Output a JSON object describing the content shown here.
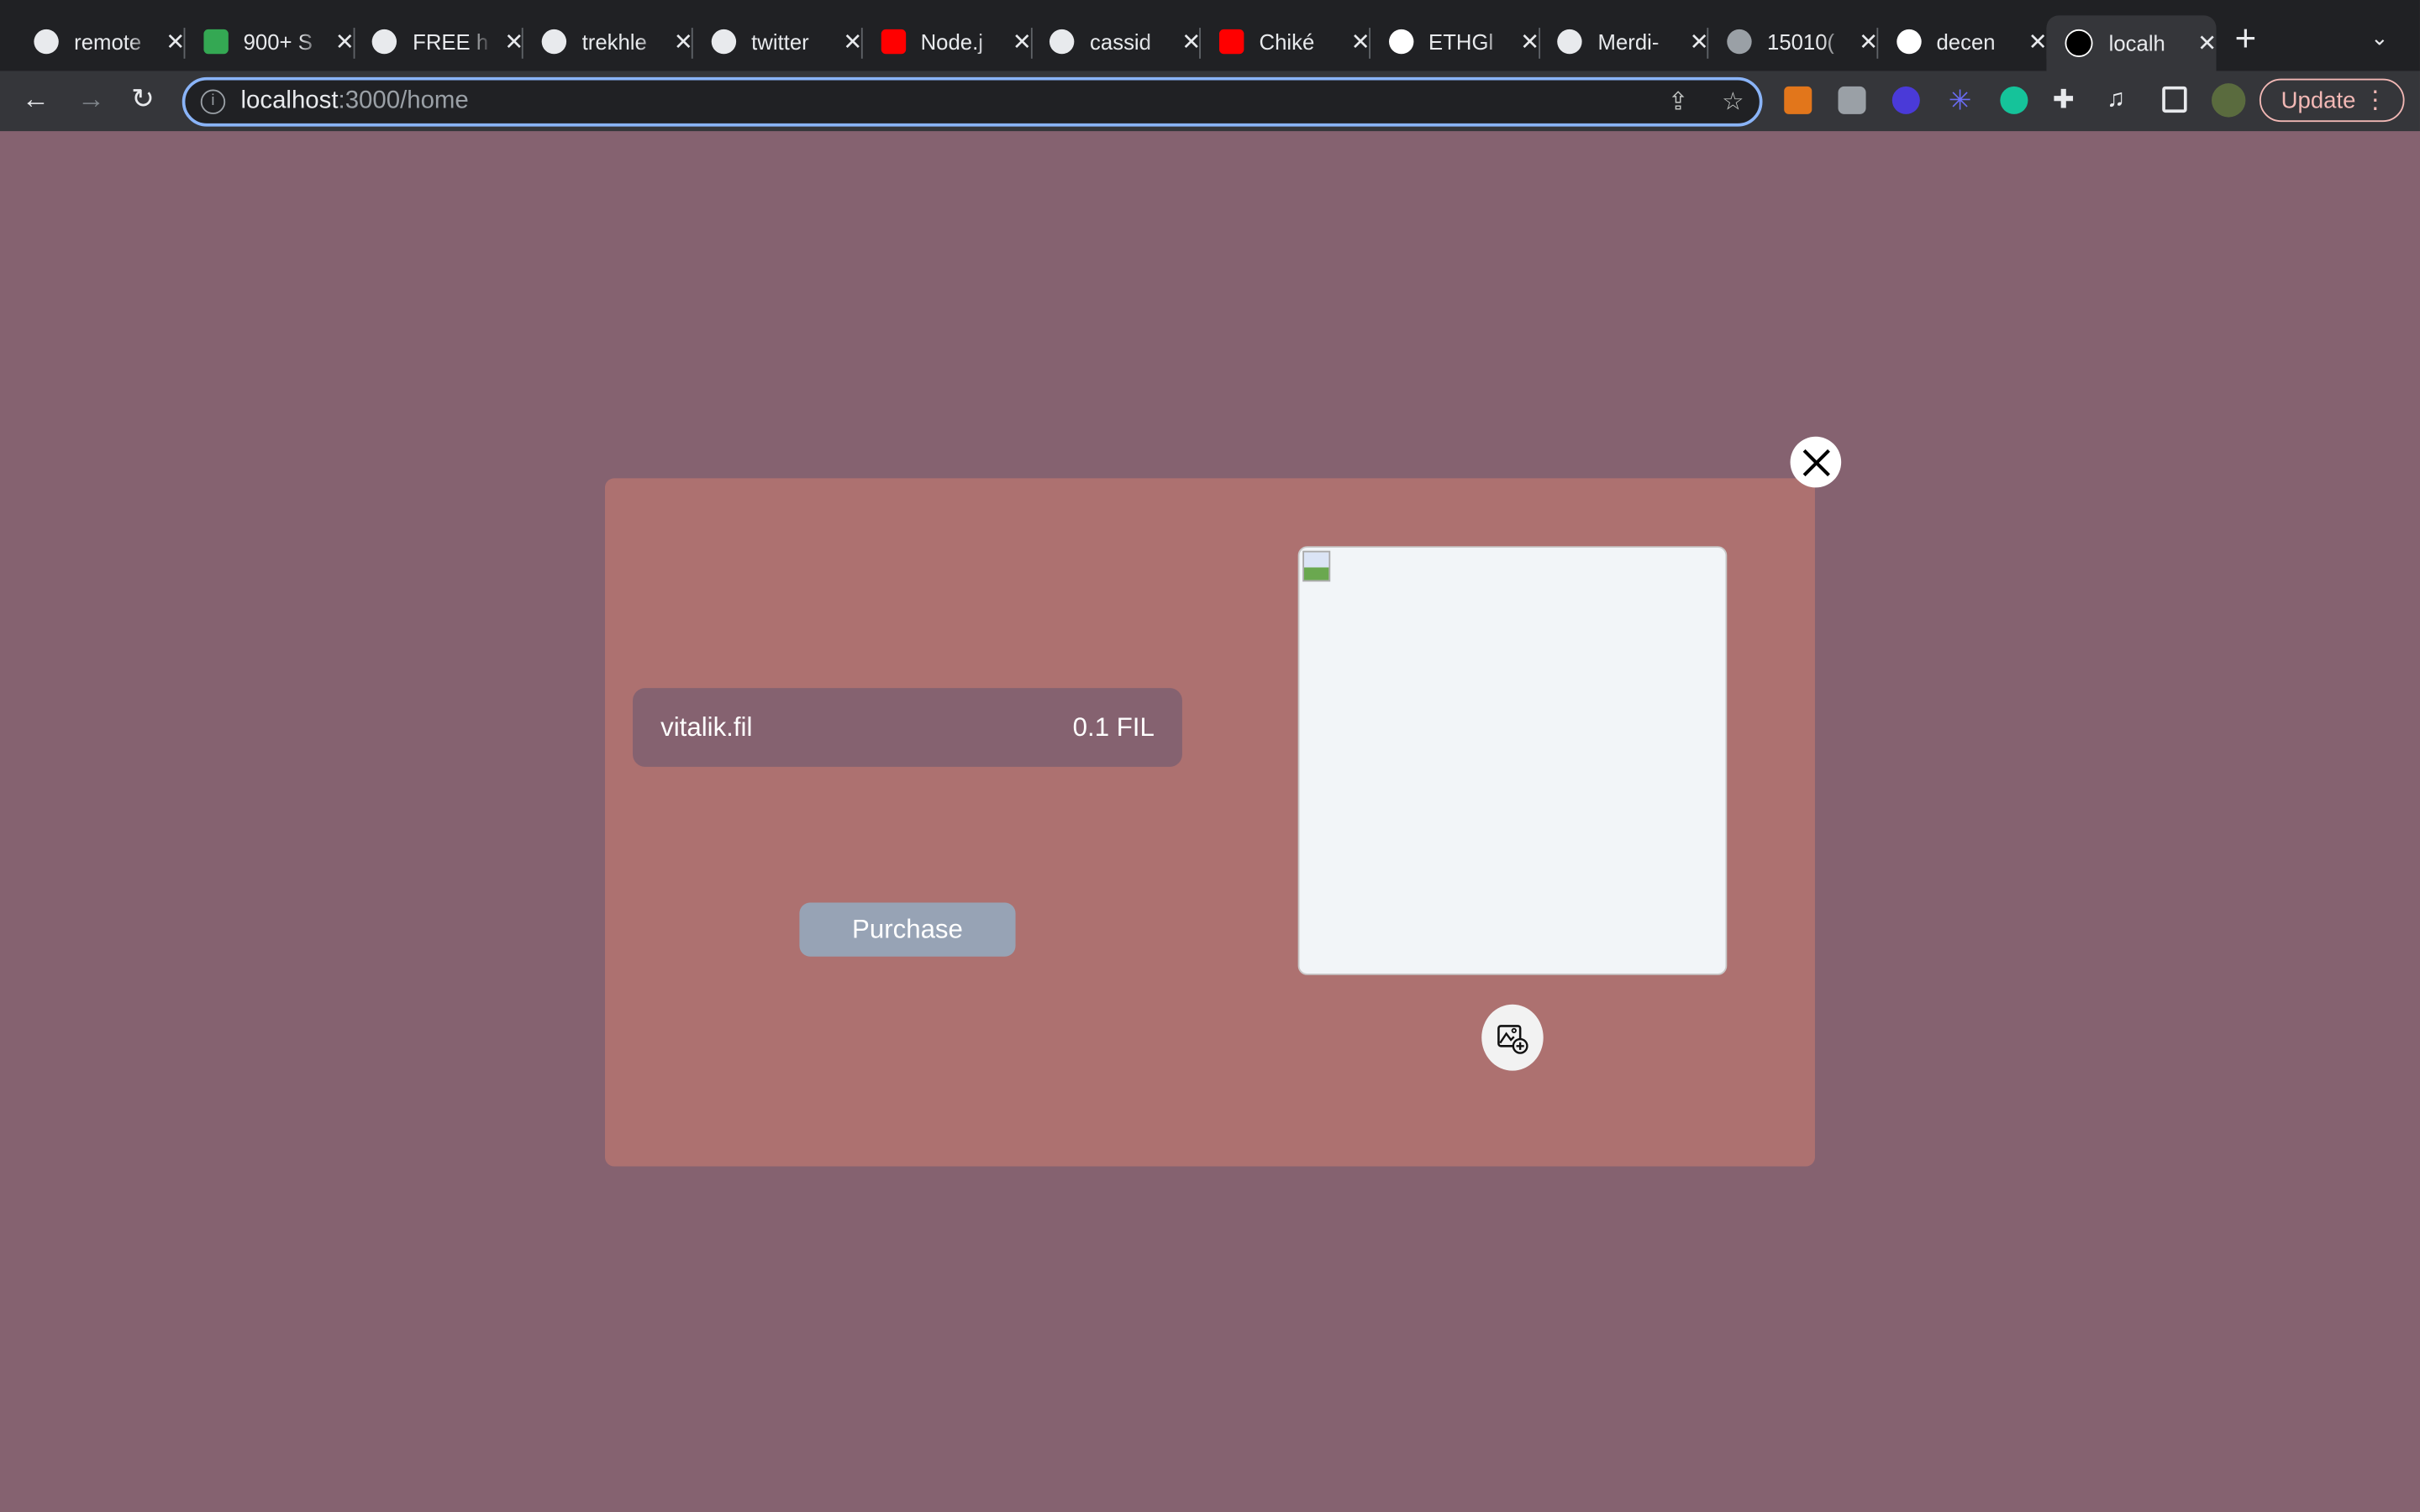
{
  "browser": {
    "tabs": [
      {
        "title": "remote",
        "icon": "github-icon"
      },
      {
        "title": "900+ S",
        "icon": "google-sheets-icon"
      },
      {
        "title": "FREE h",
        "icon": "info-icon"
      },
      {
        "title": "trekhle",
        "icon": "github-icon"
      },
      {
        "title": "twitter",
        "icon": "github-icon"
      },
      {
        "title": "Node.j",
        "icon": "youtube-icon"
      },
      {
        "title": "cassid",
        "icon": "github-icon"
      },
      {
        "title": "Chiké",
        "icon": "youtube-icon"
      },
      {
        "title": "ETHGl",
        "icon": "ethglobal-icon"
      },
      {
        "title": "Merdi-",
        "icon": "github-icon"
      },
      {
        "title": "15010(",
        "icon": "globe-icon"
      },
      {
        "title": "decen",
        "icon": "google-icon"
      },
      {
        "title": "localh",
        "icon": "nextjs-icon",
        "active": true
      }
    ],
    "url_host": "localhost",
    "url_path": ":3000/home",
    "update_label": "Update"
  },
  "modal": {
    "domain_name": "vitalik.fil",
    "price": "0.1 FIL",
    "purchase_label": "Purchase"
  },
  "colors": {
    "page_bg": "#856270",
    "modal_bg": "#ad7170",
    "button_bg": "#97a3b5",
    "omnibox_border": "#8ab4f8"
  }
}
